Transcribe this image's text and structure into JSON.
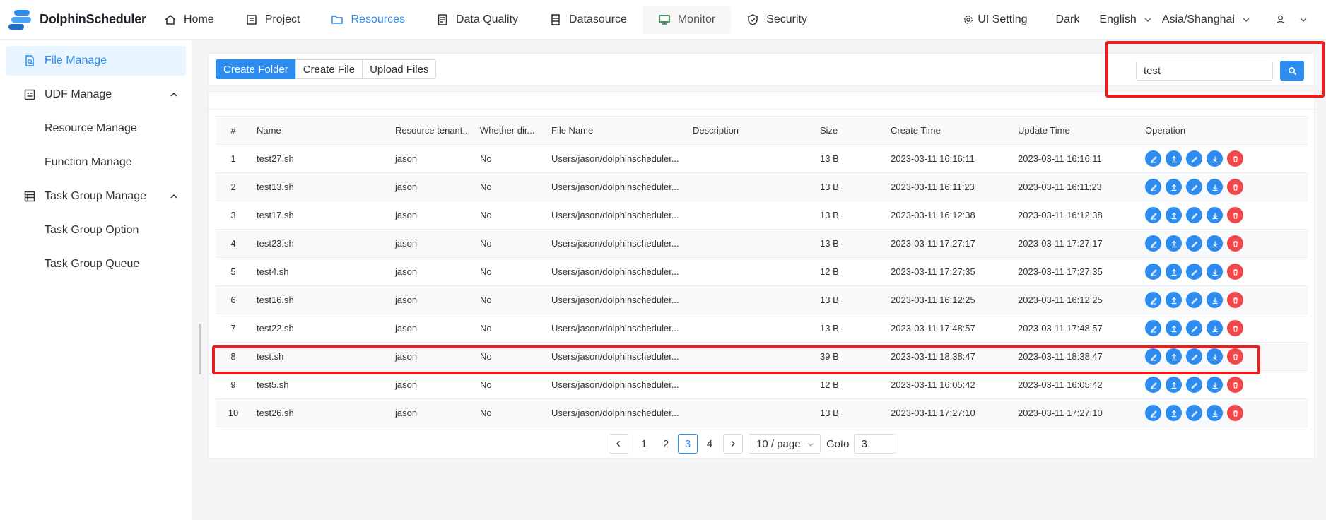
{
  "header": {
    "logo_text": "DolphinScheduler",
    "nav": [
      {
        "label": "Home"
      },
      {
        "label": "Project"
      },
      {
        "label": "Resources"
      },
      {
        "label": "Data Quality"
      },
      {
        "label": "Datasource"
      },
      {
        "label": "Monitor"
      },
      {
        "label": "Security"
      }
    ],
    "ui_setting": "UI Setting",
    "theme": "Dark",
    "language": "English",
    "timezone": "Asia/Shanghai"
  },
  "sidebar": {
    "file_manage": "File Manage",
    "udf_manage": "UDF Manage",
    "resource_manage": "Resource Manage",
    "function_manage": "Function Manage",
    "task_group_manage": "Task Group Manage",
    "task_group_option": "Task Group Option",
    "task_group_queue": "Task Group Queue"
  },
  "toolbar": {
    "create_folder": "Create Folder",
    "create_file": "Create File",
    "upload_files": "Upload Files",
    "search_value": "test"
  },
  "table": {
    "columns": [
      "#",
      "Name",
      "Resource tenant...",
      "Whether dir...",
      "File Name",
      "Description",
      "Size",
      "Create Time",
      "Update Time",
      "Operation"
    ],
    "rows": [
      {
        "num": "1",
        "name": "test27.sh",
        "tenant": "jason",
        "dir": "No",
        "file": "Users/jason/dolphinscheduler...",
        "desc": "",
        "size": "13 B",
        "create": "2023-03-11 16:16:11",
        "update": "2023-03-11 16:16:11"
      },
      {
        "num": "2",
        "name": "test13.sh",
        "tenant": "jason",
        "dir": "No",
        "file": "Users/jason/dolphinscheduler...",
        "desc": "",
        "size": "13 B",
        "create": "2023-03-11 16:11:23",
        "update": "2023-03-11 16:11:23"
      },
      {
        "num": "3",
        "name": "test17.sh",
        "tenant": "jason",
        "dir": "No",
        "file": "Users/jason/dolphinscheduler...",
        "desc": "",
        "size": "13 B",
        "create": "2023-03-11 16:12:38",
        "update": "2023-03-11 16:12:38"
      },
      {
        "num": "4",
        "name": "test23.sh",
        "tenant": "jason",
        "dir": "No",
        "file": "Users/jason/dolphinscheduler...",
        "desc": "",
        "size": "13 B",
        "create": "2023-03-11 17:27:17",
        "update": "2023-03-11 17:27:17"
      },
      {
        "num": "5",
        "name": "test4.sh",
        "tenant": "jason",
        "dir": "No",
        "file": "Users/jason/dolphinscheduler...",
        "desc": "",
        "size": "12 B",
        "create": "2023-03-11 17:27:35",
        "update": "2023-03-11 17:27:35"
      },
      {
        "num": "6",
        "name": "test16.sh",
        "tenant": "jason",
        "dir": "No",
        "file": "Users/jason/dolphinscheduler...",
        "desc": "",
        "size": "13 B",
        "create": "2023-03-11 16:12:25",
        "update": "2023-03-11 16:12:25"
      },
      {
        "num": "7",
        "name": "test22.sh",
        "tenant": "jason",
        "dir": "No",
        "file": "Users/jason/dolphinscheduler...",
        "desc": "",
        "size": "13 B",
        "create": "2023-03-11 17:48:57",
        "update": "2023-03-11 17:48:57"
      },
      {
        "num": "8",
        "name": "test.sh",
        "tenant": "jason",
        "dir": "No",
        "file": "Users/jason/dolphinscheduler...",
        "desc": "",
        "size": "39 B",
        "create": "2023-03-11 18:38:47",
        "update": "2023-03-11 18:38:47"
      },
      {
        "num": "9",
        "name": "test5.sh",
        "tenant": "jason",
        "dir": "No",
        "file": "Users/jason/dolphinscheduler...",
        "desc": "",
        "size": "12 B",
        "create": "2023-03-11 16:05:42",
        "update": "2023-03-11 16:05:42"
      },
      {
        "num": "10",
        "name": "test26.sh",
        "tenant": "jason",
        "dir": "No",
        "file": "Users/jason/dolphinscheduler...",
        "desc": "",
        "size": "13 B",
        "create": "2023-03-11 17:27:10",
        "update": "2023-03-11 17:27:10"
      }
    ]
  },
  "pagination": {
    "pages": [
      "1",
      "2",
      "3",
      "4"
    ],
    "current": "3",
    "page_size": "10 / page",
    "goto_label": "Goto",
    "goto_value": "3"
  },
  "colors": {
    "primary": "#2d8cf0",
    "danger": "#f0474b",
    "annotation": "#e8201d"
  }
}
